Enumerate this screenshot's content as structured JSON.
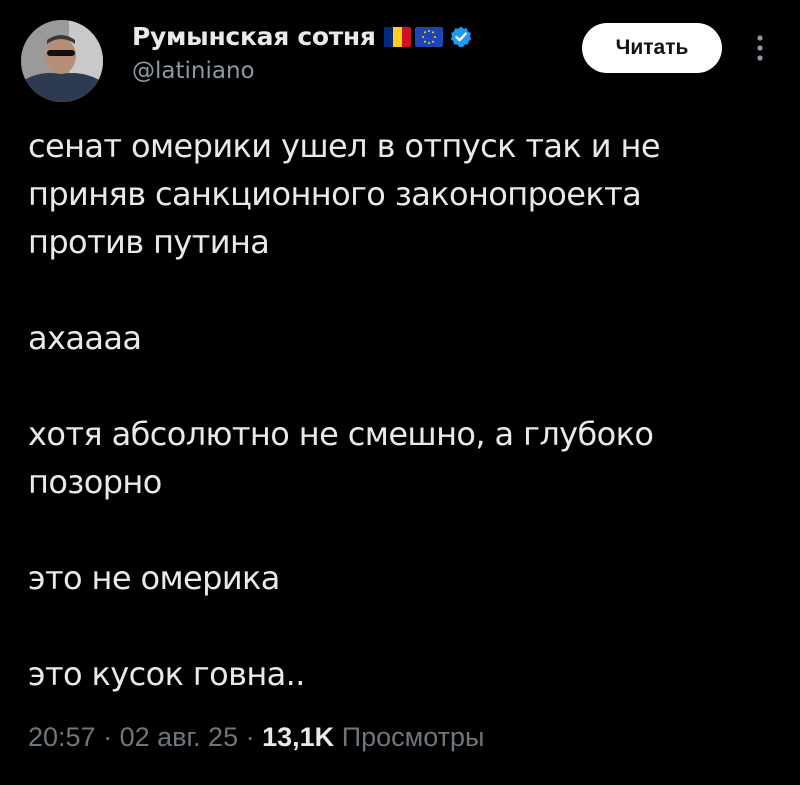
{
  "author": {
    "display_name": "Румынская сотня",
    "handle": "@latiniano",
    "flag_colors": [
      "#002b7f",
      "#fcd116",
      "#ce1126"
    ],
    "eu_flag_color": "#1f44b8",
    "verified_color": "#1d9bf0"
  },
  "follow_button": {
    "label": "Читать"
  },
  "more_icon": "more-vertical-icon",
  "tweet": {
    "paragraphs": [
      [
        "сенат омерики ушел в отпуск так и не",
        "приняв санкционного законопроекта",
        "против путина"
      ],
      [
        "ахаааа"
      ],
      [
        "хотя абсолютно не смешно, а глубоко",
        "позорно"
      ],
      [
        "это не омерика"
      ],
      [
        "это кусок говна.."
      ]
    ]
  },
  "meta": {
    "time": "20:57",
    "date": "02 авг. 25",
    "views_count": "13,1K",
    "views_label": "Просмотры",
    "separator": "·"
  }
}
